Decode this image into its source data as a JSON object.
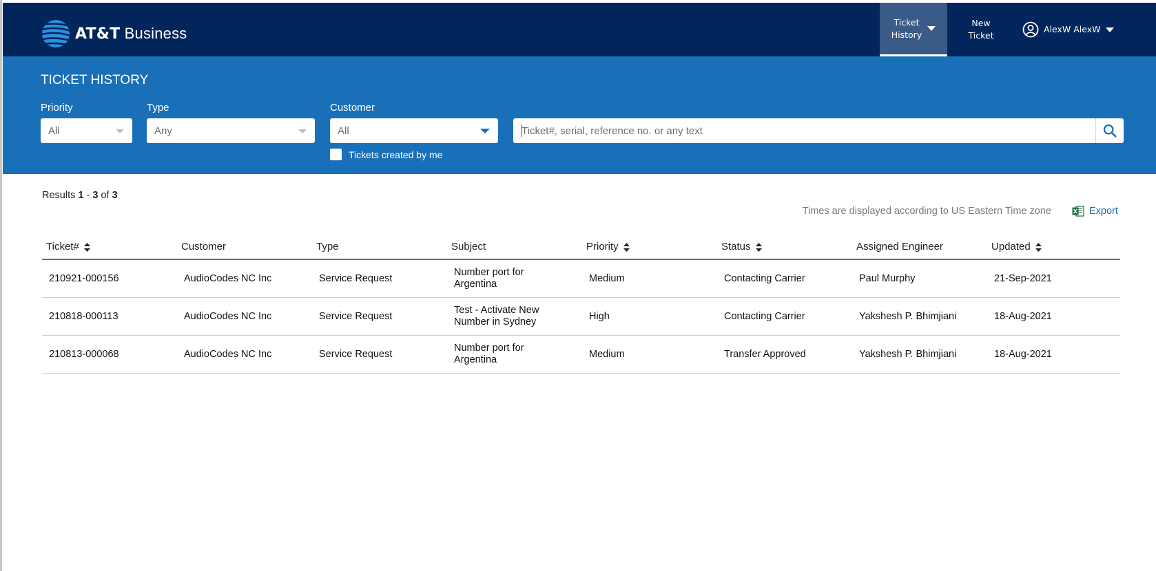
{
  "brand": {
    "name_bold": "AT&T",
    "name_rest": " Business"
  },
  "nav": {
    "ticket_history_line1": "Ticket",
    "ticket_history_line2": "History",
    "new_ticket_line1": "New",
    "new_ticket_line2": "Ticket",
    "user_name": "AlexW AlexW"
  },
  "filters": {
    "page_title": "TICKET HISTORY",
    "priority_label": "Priority",
    "priority_value": "All",
    "type_label": "Type",
    "type_value": "Any",
    "customer_label": "Customer",
    "customer_value": "All",
    "created_by_me_label": "Tickets created by me",
    "search_placeholder": "Ticket#, serial, reference no. or any text"
  },
  "results": {
    "prefix": "Results ",
    "from": "1",
    "sep": " - ",
    "to": "3",
    "of_text": " of ",
    "total": "3",
    "timezone_note": "Times are displayed according to US Eastern Time zone",
    "export_label": "Export"
  },
  "table": {
    "headers": [
      "Ticket#",
      "Customer",
      "Type",
      "Subject",
      "Priority",
      "Status",
      "Assigned Engineer",
      "Updated"
    ],
    "rows": [
      {
        "ticket": "210921-000156",
        "customer": "AudioCodes NC Inc",
        "type": "Service Request",
        "subject_1": "Number port for",
        "subject_2": "Argentina",
        "priority": "Medium",
        "status": "Contacting Carrier",
        "engineer": "Paul Murphy",
        "updated": "21-Sep-2021"
      },
      {
        "ticket": "210818-000113",
        "customer": "AudioCodes NC Inc",
        "type": "Service Request",
        "subject_1": "Test - Activate New",
        "subject_2": "Number in Sydney",
        "priority": "High",
        "status": "Contacting Carrier",
        "engineer": "Yakshesh P. Bhimjiani",
        "updated": "18-Aug-2021"
      },
      {
        "ticket": "210813-000068",
        "customer": "AudioCodes NC Inc",
        "type": "Service Request",
        "subject_1": "Number port for",
        "subject_2": "Argentina",
        "priority": "Medium",
        "status": "Transfer Approved",
        "engineer": "Yakshesh P. Bhimjiani",
        "updated": "18-Aug-2021"
      }
    ]
  },
  "colors": {
    "nav_bg": "#02265c",
    "band_bg": "#1a70b8",
    "accent": "#1a70b8"
  },
  "icons": [
    "att-globe-icon",
    "chevron-down-icon",
    "user-circle-icon",
    "search-icon",
    "excel-icon",
    "sort-icon"
  ]
}
